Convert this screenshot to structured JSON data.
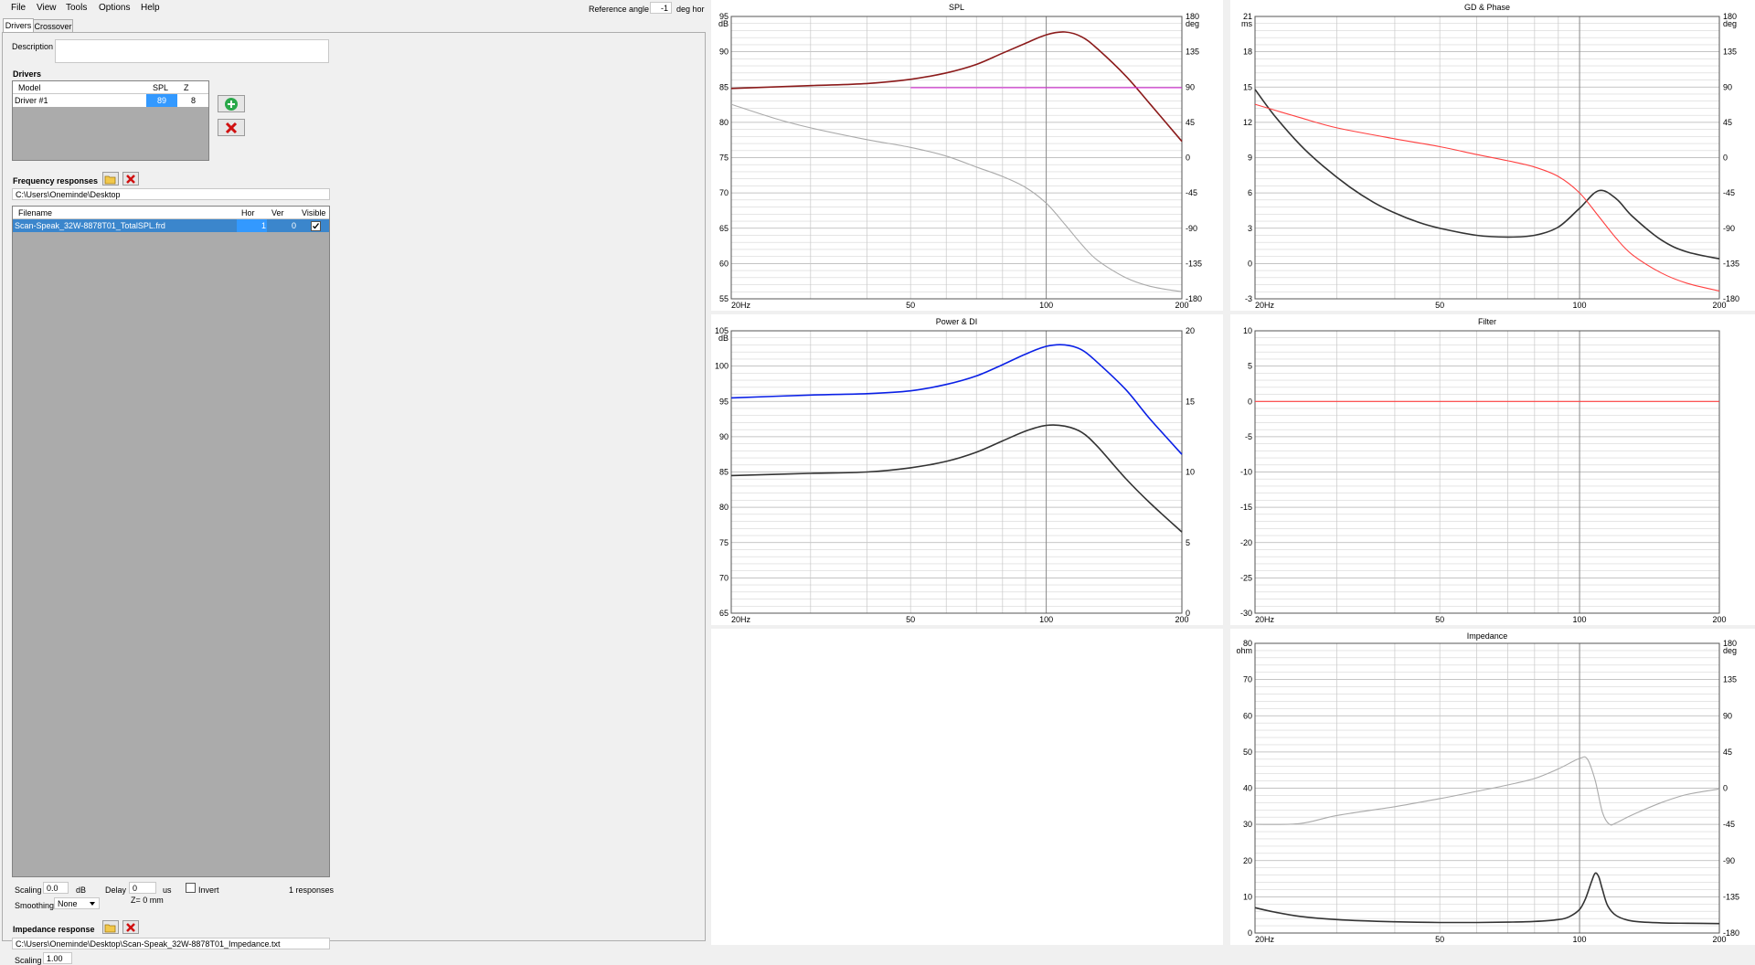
{
  "menu": [
    "File",
    "View",
    "Tools",
    "Options",
    "Help"
  ],
  "ref_angle": {
    "label": "Reference angle",
    "value": "-1",
    "unit": "deg hor"
  },
  "tabs": [
    "Drivers",
    "Crossover"
  ],
  "description_label": "Description",
  "drivers": {
    "heading": "Drivers",
    "columns": [
      "Model",
      "SPL",
      "Z"
    ],
    "rows": [
      {
        "model": "Driver #1",
        "spl": "89",
        "z": "8"
      }
    ]
  },
  "freq": {
    "heading": "Frequency responses",
    "path": "C:\\Users\\Oneminde\\Desktop",
    "columns": [
      "Filename",
      "Hor",
      "Ver",
      "Visible"
    ],
    "rows": [
      {
        "filename": "Scan-Speak_32W-8878T01_TotalSPL.frd",
        "hor": "1",
        "ver": "0",
        "visible": true
      }
    ],
    "scaling_label": "Scaling",
    "scaling_value": "0.0",
    "scaling_unit": "dB",
    "delay_label": "Delay",
    "delay_value": "0",
    "delay_unit": "us",
    "invert_label": "Invert",
    "responses": "1 responses",
    "smoothing_label": "Smoothing",
    "smoothing_value": "None",
    "z_label": "Z= 0 mm"
  },
  "impedance": {
    "heading": "Impedance response",
    "path": "C:\\Users\\Oneminde\\Desktop\\Scan-Speak_32W-8878T01_Impedance.txt",
    "scaling_label": "Scaling",
    "scaling_value": "1.00"
  },
  "colors": {
    "red": "#8b1a1a",
    "magenta": "#e020e0",
    "gray": "#aaaaaa",
    "blue": "#0a20e6",
    "dark": "#333333",
    "lightred": "#ff4040",
    "grid": "#d6d6d6",
    "gridmajor": "#888888"
  },
  "chart_data": [
    {
      "type": "line",
      "title": "SPL",
      "x_ticks": [
        "20Hz",
        "50",
        "100",
        "200"
      ],
      "xlim": [
        20,
        200
      ],
      "left_unit": "dB",
      "left_ticks": [
        "95",
        "90",
        "85",
        "80",
        "75",
        "70",
        "65",
        "60",
        "55"
      ],
      "ylim_left": [
        55,
        95
      ],
      "right_unit": "deg",
      "right_ticks": [
        "180",
        "135",
        "90",
        "45",
        "0",
        "-45",
        "-90",
        "-135",
        "-180"
      ],
      "ylim_right": [
        -180,
        180
      ],
      "series": [
        {
          "axis": "left",
          "color": "red",
          "x": [
            20,
            30,
            40,
            50,
            60,
            70,
            80,
            90,
            100,
            110,
            120,
            130,
            150,
            170,
            200
          ],
          "y": [
            84.8,
            85.2,
            85.5,
            86.1,
            87.0,
            88.2,
            89.8,
            91.2,
            92.4,
            92.8,
            92.1,
            90.4,
            86.6,
            82.6,
            77.3
          ]
        },
        {
          "axis": "left",
          "color": "magenta",
          "x": [
            50,
            200
          ],
          "y": [
            84.9,
            84.9
          ]
        },
        {
          "axis": "right",
          "color": "gray",
          "x": [
            20,
            25,
            30,
            40,
            50,
            60,
            70,
            80,
            90,
            100,
            110,
            120,
            130,
            150,
            170,
            200
          ],
          "y": [
            68,
            50,
            38,
            23,
            13,
            2,
            -12,
            -24,
            -38,
            -58,
            -85,
            -111,
            -131,
            -153,
            -164,
            -171
          ]
        }
      ]
    },
    {
      "type": "line",
      "title": "GD & Phase",
      "x_ticks": [
        "20Hz",
        "50",
        "100",
        "200"
      ],
      "xlim": [
        20,
        200
      ],
      "left_unit": "ms",
      "left_ticks": [
        "21",
        "18",
        "15",
        "12",
        "9",
        "6",
        "3",
        "0",
        "-3"
      ],
      "ylim_left": [
        -3,
        21
      ],
      "right_unit": "deg",
      "right_ticks": [
        "180",
        "135",
        "90",
        "45",
        "0",
        "-45",
        "-90",
        "-135",
        "-180"
      ],
      "ylim_right": [
        -180,
        180
      ],
      "series": [
        {
          "axis": "left",
          "color": "dark",
          "x": [
            20,
            22,
            25,
            28,
            32,
            36,
            40,
            45,
            50,
            60,
            70,
            80,
            90,
            100,
            110,
            120,
            130,
            150,
            170,
            200
          ],
          "y": [
            14.8,
            12.6,
            10.1,
            8.3,
            6.5,
            5.2,
            4.3,
            3.5,
            3.0,
            2.4,
            2.25,
            2.4,
            3.1,
            4.7,
            6.2,
            5.5,
            4.0,
            2.0,
            1.0,
            0.4
          ]
        },
        {
          "axis": "right",
          "color": "lightred",
          "x": [
            20,
            25,
            30,
            40,
            50,
            60,
            70,
            80,
            90,
            100,
            110,
            120,
            130,
            150,
            170,
            200
          ],
          "y": [
            68,
            51,
            38,
            24,
            14,
            4,
            -4,
            -12,
            -24,
            -45,
            -75,
            -103,
            -124,
            -147,
            -160,
            -170
          ]
        }
      ]
    },
    {
      "type": "line",
      "title": "Power & DI",
      "x_ticks": [
        "20Hz",
        "50",
        "100",
        "200"
      ],
      "xlim": [
        20,
        200
      ],
      "left_unit": "dB",
      "left_ticks": [
        "105",
        "100",
        "95",
        "90",
        "85",
        "80",
        "75",
        "70",
        "65"
      ],
      "ylim_left": [
        65,
        105
      ],
      "right_ticks": [
        "20",
        "15",
        "10",
        "5",
        "0"
      ],
      "ylim_right": [
        0,
        20
      ],
      "series": [
        {
          "axis": "left",
          "color": "blue",
          "x": [
            20,
            30,
            40,
            50,
            60,
            70,
            80,
            90,
            100,
            110,
            120,
            130,
            150,
            170,
            200
          ],
          "y": [
            95.5,
            95.9,
            96.1,
            96.5,
            97.4,
            98.6,
            100.2,
            101.7,
            102.8,
            103.0,
            102.3,
            100.5,
            96.7,
            92.5,
            87.5
          ]
        },
        {
          "axis": "left",
          "color": "dark",
          "x": [
            20,
            30,
            40,
            50,
            60,
            70,
            80,
            90,
            100,
            110,
            120,
            130,
            150,
            170,
            200
          ],
          "y": [
            84.5,
            84.8,
            85.0,
            85.6,
            86.5,
            87.8,
            89.4,
            90.8,
            91.6,
            91.5,
            90.6,
            88.6,
            84.1,
            80.6,
            76.5
          ]
        }
      ]
    },
    {
      "type": "line",
      "title": "Filter",
      "x_ticks": [
        "20Hz",
        "50",
        "100",
        "200"
      ],
      "xlim": [
        20,
        200
      ],
      "left_ticks": [
        "10",
        "5",
        "0",
        "-5",
        "-10",
        "-15",
        "-20",
        "-25",
        "-30"
      ],
      "ylim_left": [
        -30,
        10
      ],
      "series": [
        {
          "axis": "left",
          "color": "lightred",
          "x": [
            20,
            200
          ],
          "y": [
            0,
            0
          ]
        }
      ]
    },
    {
      "type": "line",
      "title": "Impedance",
      "x_ticks": [
        "20Hz",
        "50",
        "100",
        "200"
      ],
      "xlim": [
        20,
        200
      ],
      "left_unit": "ohm",
      "left_ticks": [
        "80",
        "70",
        "60",
        "50",
        "40",
        "30",
        "20",
        "10",
        "0"
      ],
      "ylim_left": [
        0,
        80
      ],
      "right_unit": "deg",
      "right_ticks": [
        "180",
        "135",
        "90",
        "45",
        "0",
        "-45",
        "-90",
        "-135",
        "-180"
      ],
      "ylim_right": [
        -180,
        180
      ],
      "series": [
        {
          "axis": "left",
          "color": "dark",
          "x": [
            20,
            22,
            25,
            30,
            40,
            50,
            60,
            70,
            80,
            90,
            95,
            100,
            103,
            106,
            108,
            110,
            112,
            115,
            120,
            130,
            150,
            170,
            200
          ],
          "y": [
            7.0,
            5.8,
            4.6,
            3.7,
            3.1,
            2.9,
            2.9,
            3.0,
            3.2,
            3.7,
            4.5,
            6.5,
            9.5,
            14.0,
            16.5,
            15.5,
            12.0,
            7.5,
            4.8,
            3.3,
            2.8,
            2.7,
            2.6
          ]
        },
        {
          "axis": "right",
          "color": "gray",
          "x": [
            20,
            25,
            30,
            40,
            50,
            60,
            70,
            80,
            90,
            100,
            104,
            108,
            112,
            116,
            120,
            130,
            150,
            170,
            200
          ],
          "y": [
            -45,
            -44,
            -34,
            -23,
            -13,
            -4,
            4,
            12,
            24,
            37,
            36,
            10,
            -30,
            -45,
            -43,
            -33,
            -18,
            -8,
            -1
          ]
        }
      ]
    }
  ]
}
